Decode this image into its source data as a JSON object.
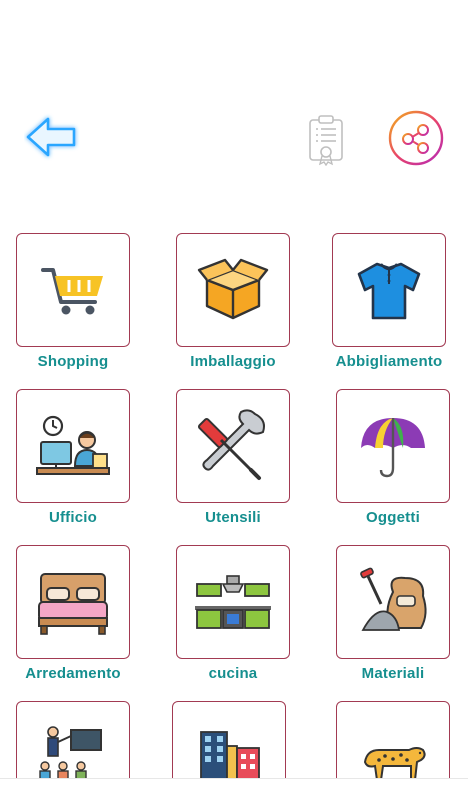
{
  "header": {
    "back_icon": "arrow-left-icon",
    "certificate_icon": "certificate-clipboard-icon",
    "share_icon": "share-icon"
  },
  "categories": [
    {
      "label": "Shopping",
      "icon": "shopping-cart-icon"
    },
    {
      "label": "Imballaggio",
      "icon": "box-icon"
    },
    {
      "label": "Abbigliamento",
      "icon": "shirt-icon"
    },
    {
      "label": "Ufficio",
      "icon": "office-worker-icon"
    },
    {
      "label": "Utensili",
      "icon": "tools-icon"
    },
    {
      "label": "Oggetti",
      "icon": "umbrella-icon"
    },
    {
      "label": "Arredamento",
      "icon": "bed-icon"
    },
    {
      "label": "cucina",
      "icon": "kitchen-icon"
    },
    {
      "label": "Materiali",
      "icon": "sack-shovel-icon"
    },
    {
      "label": "",
      "icon": "teacher-icon"
    },
    {
      "label": "",
      "icon": "buildings-icon"
    },
    {
      "label": "",
      "icon": "leopard-icon"
    }
  ]
}
